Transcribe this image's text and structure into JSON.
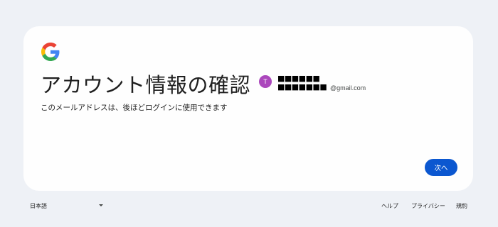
{
  "card": {
    "logo": "google-g-logo",
    "title": "アカウント情報の確認",
    "subtitle": "このメールアドレスは、後ほどログインに使用できます",
    "account": {
      "avatar_initial": "T",
      "avatar_color": "#ab47bc",
      "masked_name": "■■■■■■",
      "masked_email_local": "■■■■■■■",
      "email_domain": "@gmail.com"
    },
    "next_label": "次へ",
    "accent_color": "#0b57d0"
  },
  "footer": {
    "language": "日本語",
    "dropdown_icon": "caret-down-icon",
    "links": [
      "ヘルプ",
      "プライバシー",
      "規約"
    ]
  }
}
